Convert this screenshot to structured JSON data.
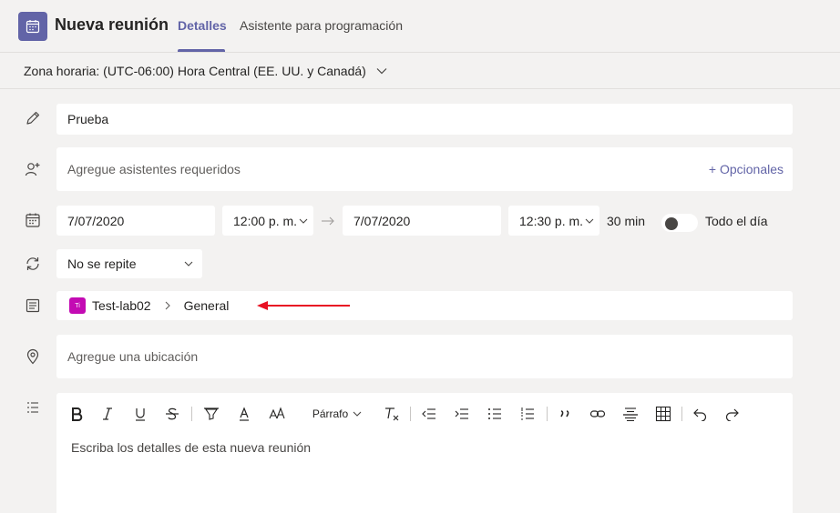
{
  "header": {
    "title": "Nueva reunión",
    "tabs": [
      {
        "label": "Detalles",
        "active": true
      },
      {
        "label": "Asistente para programación",
        "active": false
      }
    ]
  },
  "timezone": {
    "label": "Zona horaria: (UTC-06:00) Hora Central (EE. UU. y Canadá)"
  },
  "form": {
    "title_value": "Prueba",
    "attendees_placeholder": "Agregue asistentes requeridos",
    "optional_label": "+ Opcionales",
    "start_date": "7/07/2020",
    "start_time": "12:00 p. m.",
    "end_date": "7/07/2020",
    "end_time": "12:30 p. m.",
    "duration": "30 min",
    "all_day_label": "Todo el día",
    "all_day_on": false,
    "repeat_value": "No se repite",
    "channel": {
      "team_badge": "Ti",
      "team": "Test-lab02",
      "channel_name": "General"
    },
    "location_placeholder": "Agregue una ubicación"
  },
  "editor": {
    "paragraph_label": "Párrafo",
    "placeholder": "Escriba los detalles de esta nueva reunión"
  },
  "colors": {
    "accent": "#6264a7",
    "team_badge": "#c30bb3",
    "annotation_arrow": "#e81123"
  }
}
